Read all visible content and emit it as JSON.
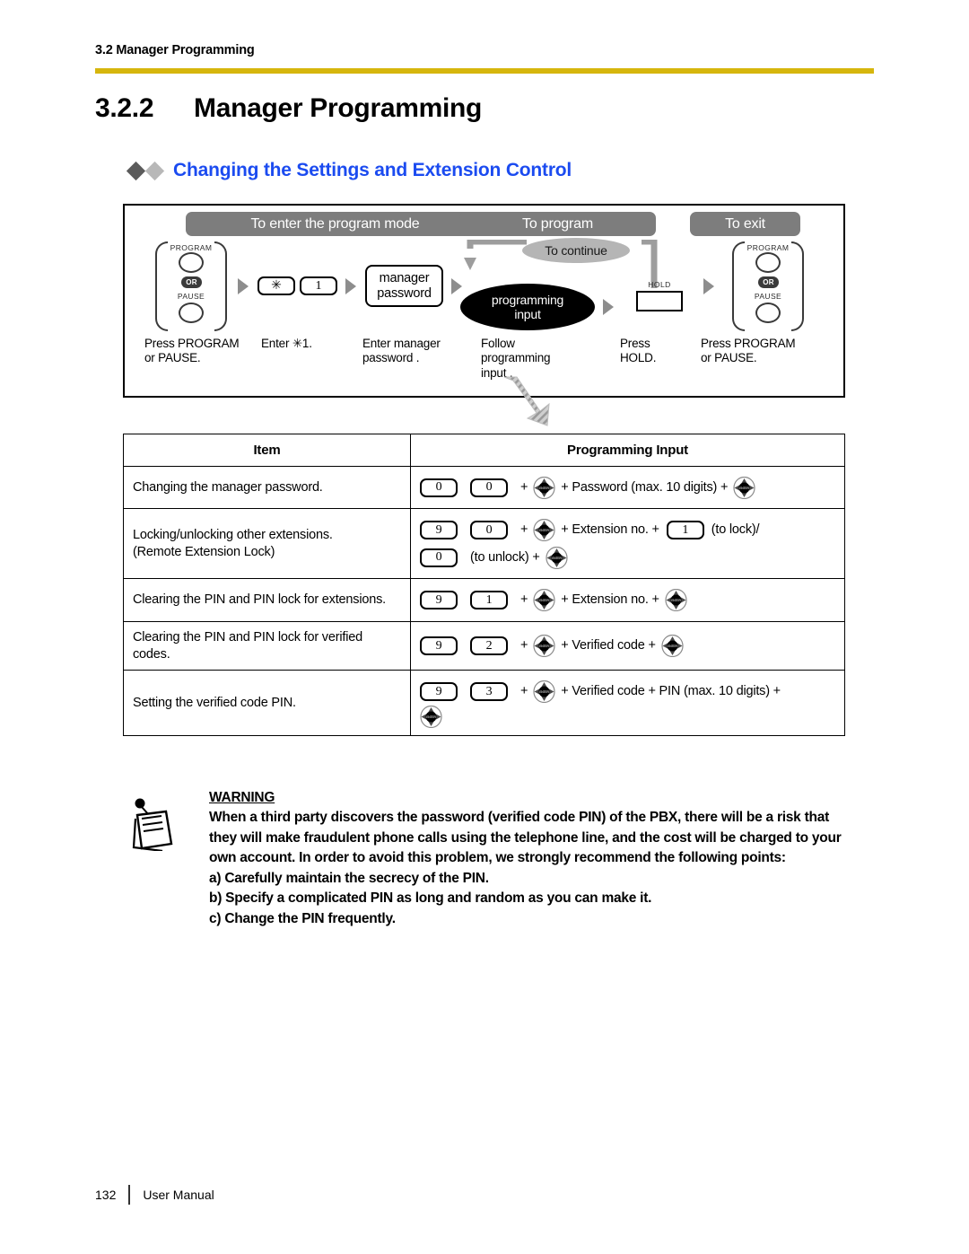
{
  "header": {
    "running_head": "3.2 Manager Programming",
    "rule_color": "#d6b60d"
  },
  "section": {
    "number": "3.2.2",
    "title": "Manager Programming"
  },
  "subheading": {
    "text": "Changing the Settings and Extension Control",
    "color": "#1b4bf0"
  },
  "flow": {
    "phases": [
      {
        "label": "To enter the program mode"
      },
      {
        "label": "To program"
      },
      {
        "label": "To exit"
      }
    ],
    "keygroup_left": {
      "top_label": "PROGRAM",
      "or_label": "OR",
      "bottom_label": "PAUSE"
    },
    "keygroup_right": {
      "top_label": "PROGRAM",
      "or_label": "OR",
      "bottom_label": "PAUSE"
    },
    "keys": {
      "star": "✳",
      "one": "1"
    },
    "manager_password_box": {
      "line1": "manager",
      "line2": "password"
    },
    "programming_input_ellipse": {
      "line1": "programming",
      "line2": "input"
    },
    "to_continue_ellipse": "To continue",
    "hold_key": {
      "label": "HOLD"
    },
    "captions": [
      "Press PROGRAM\nor PAUSE.",
      "Enter ✳1.",
      "Enter manager\npassword .",
      "Follow\nprogramming\ninput .",
      "Press\nHOLD.",
      "Press PROGRAM\nor PAUSE."
    ]
  },
  "table": {
    "headers": {
      "item": "Item",
      "programming_input": "Programming Input"
    },
    "rows": [
      {
        "item": "Changing the manager password.",
        "keys": [
          "0",
          "0"
        ],
        "sequence": [
          "+",
          "NAV",
          "+ Password (max. 10 digits) +",
          "NAV"
        ]
      },
      {
        "item": "Locking/unlocking other extensions.\n(Remote Extension Lock)",
        "keys": [
          "9",
          "0"
        ],
        "sequence": [
          "+",
          "NAV",
          "+ Extension no. +",
          "KEY:1",
          "(to lock)/"
        ],
        "sequence2": [
          "KEY:0",
          "(to unlock) +",
          "NAV"
        ]
      },
      {
        "item": "Clearing the PIN and PIN lock for extensions.",
        "keys": [
          "9",
          "1"
        ],
        "sequence": [
          "+",
          "NAV",
          "+ Extension no. +",
          "NAV"
        ]
      },
      {
        "item": "Clearing the PIN and PIN lock for verified codes.",
        "keys": [
          "9",
          "2"
        ],
        "sequence": [
          "+",
          "NAV",
          "+ Verified code +",
          "NAV"
        ]
      },
      {
        "item": "Setting the verified code PIN.",
        "keys": [
          "9",
          "3"
        ],
        "sequence": [
          "+",
          "NAV",
          "+ Verified code + PIN (max. 10 digits) +"
        ],
        "sequence2": [
          "NAV"
        ]
      }
    ]
  },
  "warning": {
    "title": "WARNING",
    "paragraph": "When a third party discovers the password (verified code PIN) of the PBX, there will be a risk that they will make fraudulent phone calls using the telephone line, and the cost will be charged to your own account. In order to avoid this problem, we strongly recommend the following points:",
    "points": [
      "a) Carefully maintain the secrecy of the PIN.",
      "b) Specify a complicated PIN as long and random as you can make it.",
      "c) Change the PIN frequently."
    ]
  },
  "footer": {
    "page_number": "132",
    "doc_title": "User Manual"
  }
}
